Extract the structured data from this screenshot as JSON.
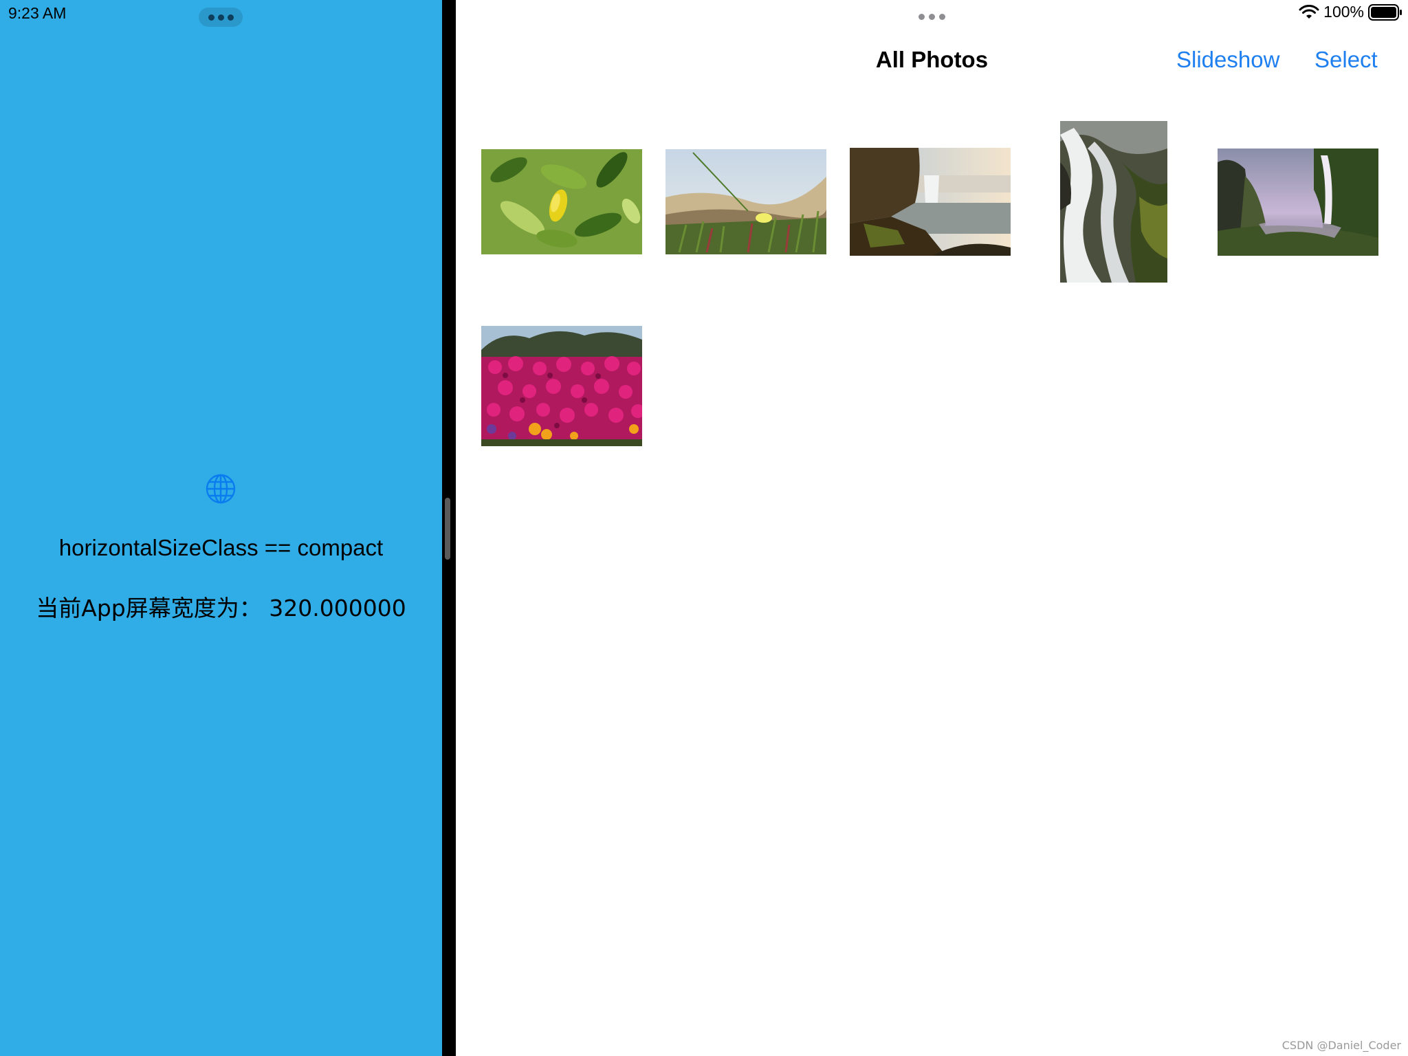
{
  "left_pane": {
    "status_time": "9:23 AM",
    "size_class_text": "horizontalSizeClass == compact",
    "screen_width_text": "当前App屏幕宽度为： 320.000000",
    "background_color": "#30ade6",
    "globe_icon": "globe-icon"
  },
  "right_pane": {
    "battery_percent": "100%",
    "nav": {
      "title": "All Photos",
      "slideshow_label": "Slideshow",
      "select_label": "Select"
    },
    "photos": [
      {
        "subject": "lemon-leaves"
      },
      {
        "subject": "beach-grass-flower"
      },
      {
        "subject": "waterfall-coast"
      },
      {
        "subject": "waterfall-rocks"
      },
      {
        "subject": "waterfall-cliff"
      },
      {
        "subject": "pink-flowers"
      }
    ],
    "accent_color": "#1e7ff0"
  },
  "watermark": "CSDN @Daniel_Coder"
}
